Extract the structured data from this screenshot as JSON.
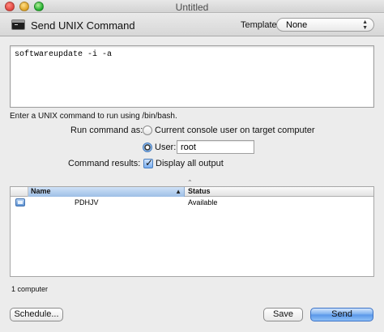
{
  "window": {
    "title": "Untitled"
  },
  "header": {
    "title": "Send UNIX Command",
    "template_label": "Template:",
    "template_value": "None"
  },
  "command": {
    "value": "softwareupdate -i -a"
  },
  "hint": "Enter a UNIX command to run using /bin/bash.",
  "run_as": {
    "label": "Run command as:",
    "option_console": "Current console user on target computer",
    "option_user": "User:",
    "user_value": "root",
    "selected": "user"
  },
  "results": {
    "label": "Command results:",
    "display_all_label": "Display all output",
    "display_all_checked": true
  },
  "table": {
    "columns": [
      "Name",
      "Status"
    ],
    "sort_column": "Name",
    "sort_direction": "ascending",
    "rows": [
      {
        "name": "PDHJV",
        "status": "Available",
        "icon": "computer-icon"
      }
    ]
  },
  "count": "1 computer",
  "buttons": {
    "schedule": "Schedule...",
    "save": "Save",
    "send": "Send"
  }
}
